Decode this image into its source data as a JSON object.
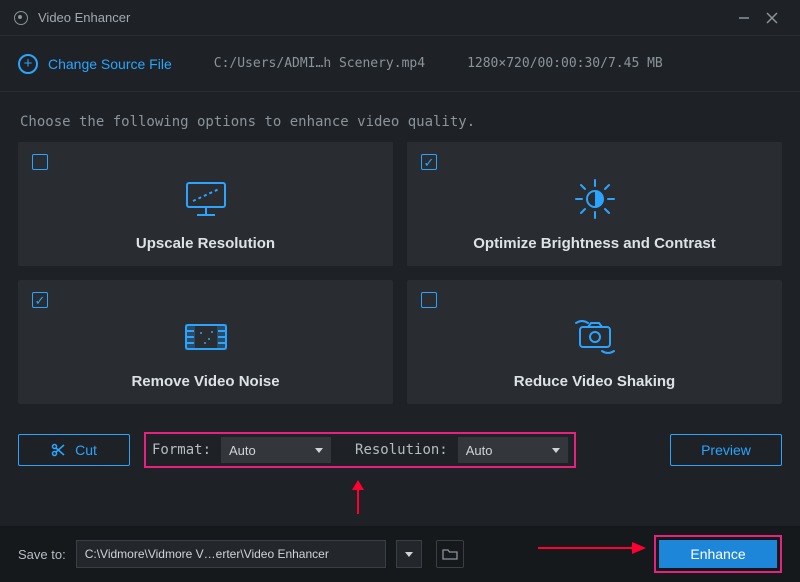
{
  "app": {
    "title": "Video Enhancer"
  },
  "toolbar": {
    "change_source": "Change Source File",
    "source_path": "C:/Users/ADMI…h Scenery.mp4",
    "file_meta": "1280×720/00:00:30/7.45 MB"
  },
  "instruction": "Choose the following options to enhance video quality.",
  "cards": {
    "upscale": {
      "label": "Upscale Resolution",
      "checked": false
    },
    "brightness": {
      "label": "Optimize Brightness and Contrast",
      "checked": true
    },
    "noise": {
      "label": "Remove Video Noise",
      "checked": true
    },
    "shaking": {
      "label": "Reduce Video Shaking",
      "checked": false
    }
  },
  "controls": {
    "cut": "Cut",
    "format_label": "Format:",
    "format_value": "Auto",
    "resolution_label": "Resolution:",
    "resolution_value": "Auto",
    "preview": "Preview"
  },
  "bottom": {
    "save_to_label": "Save to:",
    "save_path": "C:\\Vidmore\\Vidmore V…erter\\Video Enhancer",
    "enhance": "Enhance"
  }
}
